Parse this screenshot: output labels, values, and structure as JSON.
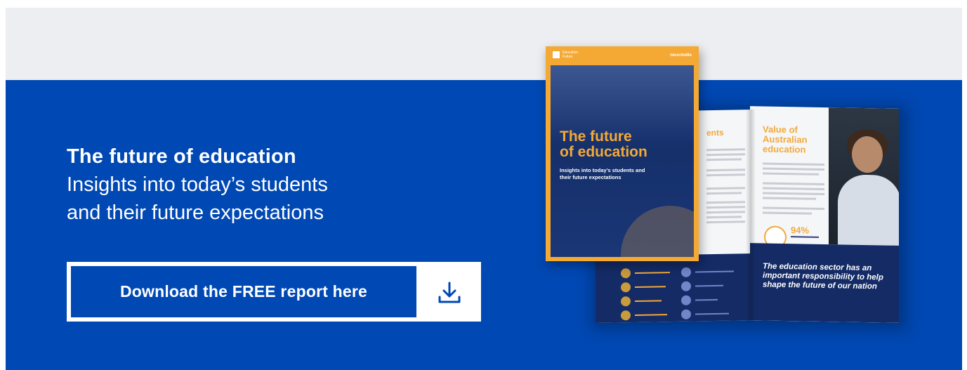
{
  "hero": {
    "title": "The future of education",
    "subtitle_line1": "Insights into today’s students",
    "subtitle_line2": "and their future expectations"
  },
  "cta": {
    "label": "Download the FREE report here",
    "icon": "download-icon"
  },
  "report_cover": {
    "logo_text": "Education Future",
    "brand": "mccrindle",
    "title_line1": "The future",
    "title_line2": "of education",
    "subtitle": "Insights into today’s students and their future expectations"
  },
  "report_spread": {
    "left_heading": "ents",
    "right_heading_line1": "Value of",
    "right_heading_line2": "Australian",
    "right_heading_line3": "education",
    "stat": "94%",
    "quote": "The education sector has an important responsibility to help shape the future of our nation"
  },
  "colors": {
    "brand_blue": "#0048b3",
    "top_band": "#eceef1",
    "accent_orange": "#f4a935",
    "navy": "#142b66"
  }
}
